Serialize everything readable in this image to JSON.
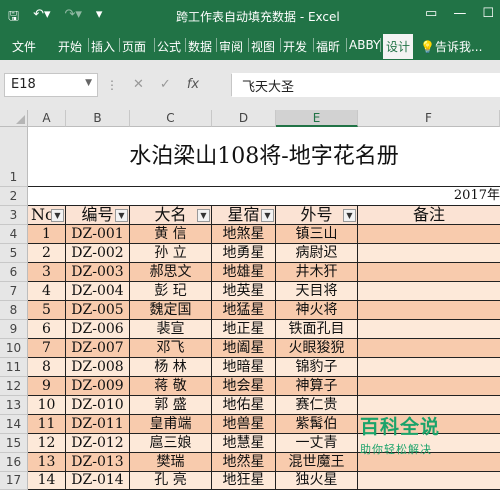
{
  "window": {
    "title": "跨工作表自动填充数据 - Excel"
  },
  "ribbon_tabs": [
    "文件",
    "开始",
    "插入",
    "页面",
    "公式",
    "数据",
    "审阅",
    "视图",
    "开发",
    "福昕",
    "ABBY",
    "设计"
  ],
  "help_label": "告诉我...",
  "name_box": "E18",
  "formula_value": "飞天大圣",
  "columns": [
    "A",
    "B",
    "C",
    "D",
    "E",
    "F"
  ],
  "rows": [
    "1",
    "2",
    "3",
    "4",
    "5",
    "6",
    "7",
    "8",
    "9",
    "10",
    "11",
    "12",
    "13",
    "14",
    "15",
    "16",
    "17"
  ],
  "sheet": {
    "title": "水泊梁山108将-地字花名册",
    "year": "2017年",
    "headers": [
      "No",
      "编号",
      "大名",
      "星宿",
      "外号",
      "备注"
    ],
    "records": [
      [
        "1",
        "DZ-001",
        "黄 信",
        "地煞星",
        "镇三山",
        ""
      ],
      [
        "2",
        "DZ-002",
        "孙 立",
        "地勇星",
        "病尉迟",
        ""
      ],
      [
        "3",
        "DZ-003",
        "郝思文",
        "地雄星",
        "井木犴",
        ""
      ],
      [
        "4",
        "DZ-004",
        "彭 玘",
        "地英星",
        "天目将",
        ""
      ],
      [
        "5",
        "DZ-005",
        "魏定国",
        "地猛星",
        "神火将",
        ""
      ],
      [
        "6",
        "DZ-006",
        "裴宣",
        "地正星",
        "铁面孔目",
        ""
      ],
      [
        "7",
        "DZ-007",
        "邓飞",
        "地阖星",
        "火眼狻猊",
        ""
      ],
      [
        "8",
        "DZ-008",
        "杨 林",
        "地暗星",
        "锦豹子",
        ""
      ],
      [
        "9",
        "DZ-009",
        "蒋 敬",
        "地会星",
        "神算子",
        ""
      ],
      [
        "10",
        "DZ-010",
        "郭 盛",
        "地佑星",
        "赛仁贵",
        ""
      ],
      [
        "11",
        "DZ-011",
        "皇甫端",
        "地兽星",
        "紫髯伯",
        ""
      ],
      [
        "12",
        "DZ-012",
        "扈三娘",
        "地慧星",
        "一丈青",
        ""
      ],
      [
        "13",
        "DZ-013",
        "樊瑞",
        "地然星",
        "混世魔王",
        ""
      ],
      [
        "14",
        "DZ-014",
        "孔 亮",
        "地狂星",
        "独火星",
        ""
      ]
    ]
  },
  "colors": {
    "excel_green": "#217346",
    "row_odd": "#f8cbad",
    "row_even": "#fde9d9"
  },
  "watermark": {
    "title": "百科全说",
    "subtitle": "助你轻松解决"
  }
}
